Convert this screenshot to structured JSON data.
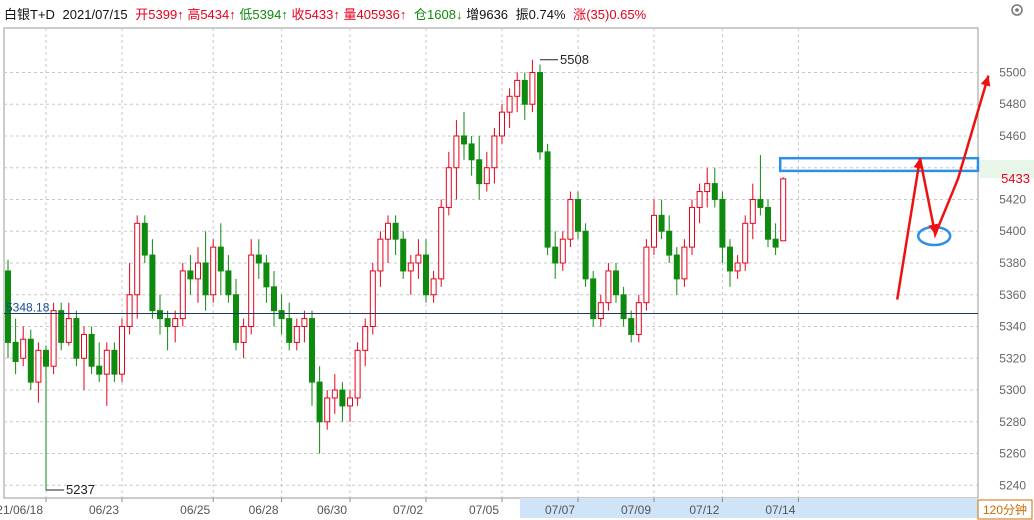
{
  "header": {
    "symbol": "白银T+D",
    "date": "2021/07/15",
    "open_label": "开",
    "open": "5399",
    "high_label": "高",
    "high": "5434",
    "low_label": "低",
    "low": "5394",
    "close_label": "收",
    "close": "5433",
    "volume_label": "量",
    "volume": "405936",
    "oi_label": "仓",
    "oi": "1608",
    "oi_change_label": "增",
    "oi_change": "9636",
    "amp_label": "振",
    "amp": "0.74%",
    "chg_label": "涨",
    "chg": "(35)",
    "chg_pct": "0.65%"
  },
  "period_label": "120分钟",
  "colors": {
    "up": "#e8001c",
    "down": "#0e8a0e",
    "grid": "#c8c8c8",
    "axis": "#666666",
    "blue": "#2d8fe6",
    "arrow": "#ee1111"
  },
  "chart_data": {
    "type": "candlestick",
    "y_axis": {
      "ticks": [
        5240,
        5260,
        5280,
        5300,
        5320,
        5340,
        5360,
        5380,
        5400,
        5420,
        5440,
        5460,
        5480,
        5500
      ],
      "range": [
        5232,
        5528
      ]
    },
    "x_labels": [
      "2021/06/18",
      "06/23",
      "06/25",
      "06/28",
      "06/30",
      "07/02",
      "07/05",
      "07/07",
      "07/09",
      "07/12",
      "07/14"
    ],
    "x_label_bars": [
      5,
      15,
      27,
      36,
      45,
      55,
      65,
      75,
      85,
      94,
      104
    ],
    "reference_line": 5348.18,
    "reference_label": "5348.18",
    "last_price": 5433,
    "last_price_label": "5433",
    "annotations": [
      {
        "text": "5508",
        "value": 5508,
        "bar": 70
      },
      {
        "text": "5237",
        "value": 5237,
        "bar": 5
      }
    ],
    "candles": [
      [
        5375,
        5382,
        5320,
        5330
      ],
      [
        5330,
        5345,
        5310,
        5318
      ],
      [
        5320,
        5340,
        5315,
        5332
      ],
      [
        5332,
        5338,
        5300,
        5305
      ],
      [
        5305,
        5330,
        5292,
        5325
      ],
      [
        5325,
        5328,
        5237,
        5315
      ],
      [
        5315,
        5355,
        5310,
        5350
      ],
      [
        5350,
        5355,
        5325,
        5330
      ],
      [
        5330,
        5355,
        5328,
        5345
      ],
      [
        5345,
        5350,
        5315,
        5320
      ],
      [
        5320,
        5340,
        5300,
        5335
      ],
      [
        5335,
        5340,
        5310,
        5315
      ],
      [
        5315,
        5330,
        5305,
        5310
      ],
      [
        5310,
        5330,
        5290,
        5325
      ],
      [
        5325,
        5330,
        5305,
        5310
      ],
      [
        5310,
        5345,
        5305,
        5340
      ],
      [
        5340,
        5380,
        5335,
        5360
      ],
      [
        5360,
        5410,
        5345,
        5405
      ],
      [
        5405,
        5410,
        5380,
        5385
      ],
      [
        5385,
        5395,
        5345,
        5350
      ],
      [
        5350,
        5360,
        5335,
        5345
      ],
      [
        5345,
        5350,
        5325,
        5340
      ],
      [
        5340,
        5350,
        5330,
        5345
      ],
      [
        5345,
        5380,
        5340,
        5375
      ],
      [
        5375,
        5385,
        5360,
        5370
      ],
      [
        5370,
        5390,
        5355,
        5380
      ],
      [
        5380,
        5400,
        5350,
        5360
      ],
      [
        5360,
        5395,
        5355,
        5390
      ],
      [
        5390,
        5405,
        5360,
        5375
      ],
      [
        5375,
        5385,
        5355,
        5360
      ],
      [
        5360,
        5370,
        5325,
        5330
      ],
      [
        5330,
        5345,
        5320,
        5340
      ],
      [
        5340,
        5395,
        5335,
        5385
      ],
      [
        5385,
        5395,
        5370,
        5380
      ],
      [
        5380,
        5385,
        5355,
        5365
      ],
      [
        5365,
        5375,
        5340,
        5350
      ],
      [
        5350,
        5360,
        5335,
        5345
      ],
      [
        5345,
        5355,
        5325,
        5330
      ],
      [
        5330,
        5345,
        5325,
        5340
      ],
      [
        5340,
        5350,
        5330,
        5345
      ],
      [
        5345,
        5350,
        5290,
        5305
      ],
      [
        5305,
        5315,
        5260,
        5280
      ],
      [
        5280,
        5300,
        5275,
        5295
      ],
      [
        5295,
        5310,
        5285,
        5300
      ],
      [
        5300,
        5305,
        5280,
        5290
      ],
      [
        5290,
        5300,
        5280,
        5295
      ],
      [
        5295,
        5330,
        5290,
        5325
      ],
      [
        5325,
        5345,
        5315,
        5340
      ],
      [
        5340,
        5380,
        5335,
        5375
      ],
      [
        5375,
        5400,
        5365,
        5395
      ],
      [
        5395,
        5410,
        5380,
        5405
      ],
      [
        5405,
        5410,
        5385,
        5395
      ],
      [
        5395,
        5400,
        5370,
        5375
      ],
      [
        5375,
        5385,
        5360,
        5380
      ],
      [
        5380,
        5395,
        5370,
        5385
      ],
      [
        5385,
        5395,
        5355,
        5360
      ],
      [
        5360,
        5375,
        5355,
        5370
      ],
      [
        5370,
        5420,
        5365,
        5415
      ],
      [
        5415,
        5450,
        5410,
        5440
      ],
      [
        5440,
        5470,
        5420,
        5460
      ],
      [
        5460,
        5475,
        5445,
        5455
      ],
      [
        5455,
        5460,
        5435,
        5445
      ],
      [
        5445,
        5460,
        5420,
        5430
      ],
      [
        5430,
        5450,
        5425,
        5440
      ],
      [
        5440,
        5465,
        5430,
        5460
      ],
      [
        5460,
        5480,
        5455,
        5475
      ],
      [
        5475,
        5490,
        5465,
        5485
      ],
      [
        5485,
        5500,
        5475,
        5495
      ],
      [
        5495,
        5500,
        5470,
        5480
      ],
      [
        5480,
        5508,
        5475,
        5500
      ],
      [
        5500,
        5505,
        5445,
        5450
      ],
      [
        5450,
        5455,
        5385,
        5390
      ],
      [
        5390,
        5400,
        5370,
        5380
      ],
      [
        5380,
        5400,
        5375,
        5395
      ],
      [
        5395,
        5425,
        5390,
        5420
      ],
      [
        5420,
        5425,
        5395,
        5400
      ],
      [
        5400,
        5405,
        5365,
        5370
      ],
      [
        5370,
        5375,
        5340,
        5345
      ],
      [
        5345,
        5360,
        5340,
        5355
      ],
      [
        5355,
        5380,
        5350,
        5375
      ],
      [
        5375,
        5380,
        5355,
        5360
      ],
      [
        5360,
        5365,
        5340,
        5345
      ],
      [
        5345,
        5350,
        5330,
        5335
      ],
      [
        5335,
        5360,
        5330,
        5355
      ],
      [
        5355,
        5395,
        5350,
        5390
      ],
      [
        5390,
        5420,
        5385,
        5410
      ],
      [
        5410,
        5420,
        5395,
        5400
      ],
      [
        5400,
        5410,
        5380,
        5385
      ],
      [
        5385,
        5390,
        5360,
        5370
      ],
      [
        5370,
        5395,
        5365,
        5390
      ],
      [
        5390,
        5420,
        5385,
        5415
      ],
      [
        5415,
        5430,
        5405,
        5425
      ],
      [
        5425,
        5440,
        5415,
        5430
      ],
      [
        5430,
        5440,
        5415,
        5420
      ],
      [
        5420,
        5425,
        5380,
        5390
      ],
      [
        5390,
        5395,
        5365,
        5375
      ],
      [
        5375,
        5385,
        5370,
        5380
      ],
      [
        5380,
        5410,
        5375,
        5405
      ],
      [
        5405,
        5430,
        5395,
        5420
      ],
      [
        5420,
        5448,
        5410,
        5415
      ],
      [
        5415,
        5420,
        5390,
        5395
      ],
      [
        5395,
        5405,
        5385,
        5390
      ],
      [
        5394,
        5434,
        5394,
        5433
      ]
    ]
  }
}
